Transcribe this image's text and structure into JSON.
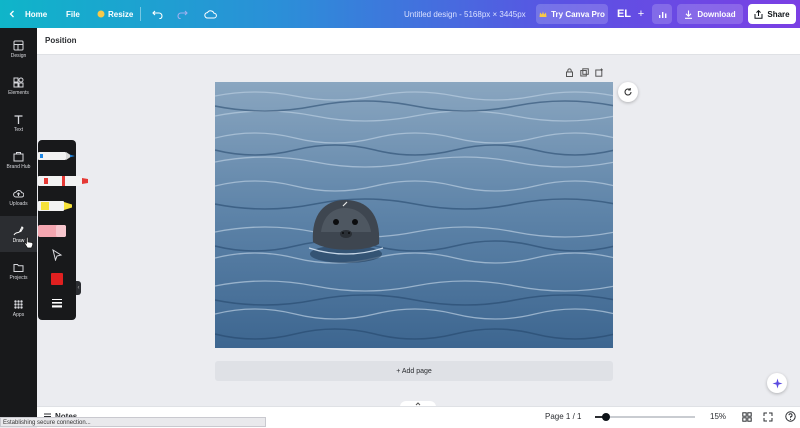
{
  "topbar": {
    "home": "Home",
    "file": "File",
    "resize": "Resize",
    "title": "Untitled design - 5168px × 3445px",
    "try_pro": "Try Canva Pro",
    "avatar": "EL",
    "download": "Download",
    "share": "Share"
  },
  "sidebar": {
    "items": [
      {
        "label": "Design"
      },
      {
        "label": "Elements"
      },
      {
        "label": "Text"
      },
      {
        "label": "Brand Hub"
      },
      {
        "label": "Uploads"
      },
      {
        "label": "Draw"
      },
      {
        "label": "Projects"
      },
      {
        "label": "Apps"
      }
    ]
  },
  "draw_tools": {
    "pen_color": "#1e88e5",
    "marker_color": "#e53935",
    "highlighter_color": "#f6e23a",
    "eraser_color": "#f4a6b0",
    "swatch_color": "#e02020"
  },
  "context_bar": {
    "position": "Position"
  },
  "canvas": {
    "add_page": "+ Add page"
  },
  "bottombar": {
    "notes": "Notes",
    "page": "Page 1 / 1",
    "zoom": "15%"
  },
  "status": "Establishing secure connection..."
}
